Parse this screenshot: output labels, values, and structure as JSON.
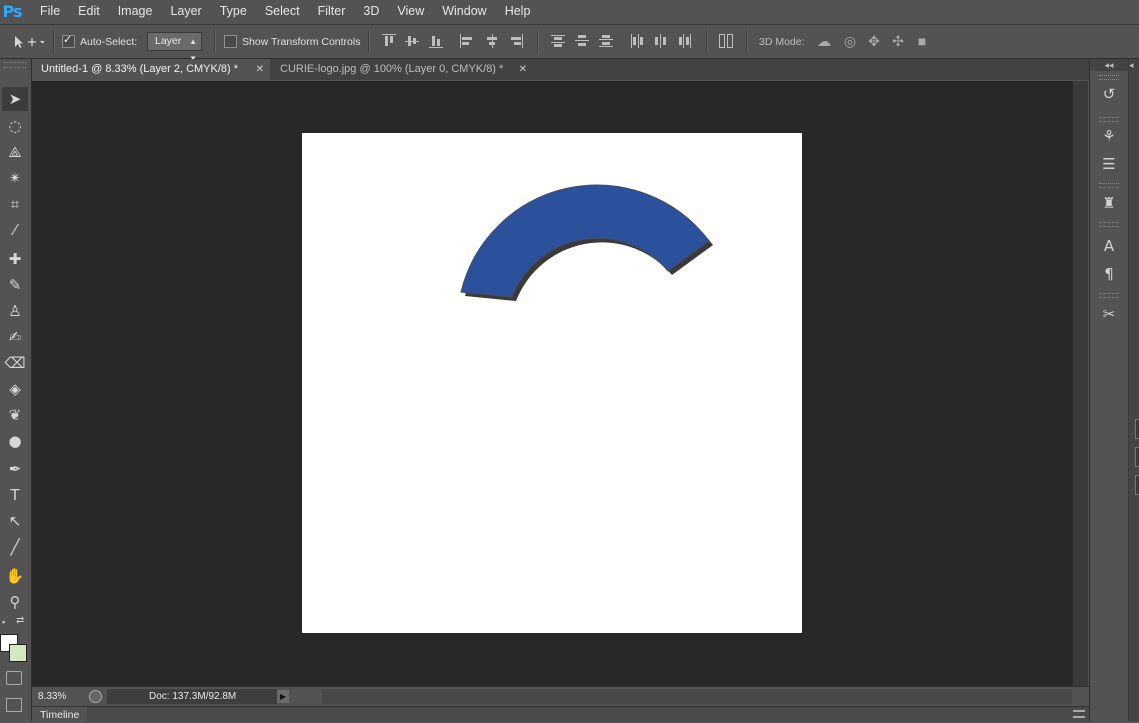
{
  "app": {
    "logo": "Ps"
  },
  "menubar": {
    "items": [
      "File",
      "Edit",
      "Image",
      "Layer",
      "Type",
      "Select",
      "Filter",
      "3D",
      "View",
      "Window",
      "Help"
    ]
  },
  "options": {
    "tool_icon": "move-tool-icon",
    "auto_select_label": "Auto-Select:",
    "auto_select_checked": true,
    "auto_select_target": "Layer",
    "show_transform_label": "Show Transform Controls",
    "show_transform_checked": false,
    "mode_3d_label": "3D Mode:"
  },
  "tabs": [
    {
      "label": "Untitled-1 @ 8.33% (Layer 2, CMYK/8) *",
      "active": true
    },
    {
      "label": "CURIE-logo.jpg @ 100% (Layer 0, CMYK/8) *",
      "active": false
    }
  ],
  "tools": [
    "move",
    "marquee",
    "lasso",
    "magic-wand",
    "crop",
    "eyedropper",
    "healing-brush",
    "brush",
    "clone-stamp",
    "history-brush",
    "eraser",
    "paint-bucket",
    "blur",
    "dodge",
    "pen",
    "type",
    "path-selection",
    "line",
    "hand",
    "zoom"
  ],
  "colors": {
    "foreground": "#ffffff",
    "background": "#d4e7c0",
    "canvas": "#ffffff",
    "arc_fill": "#2c519c",
    "arc_shadow": "#3a3a3a"
  },
  "status": {
    "zoom": "8.33%",
    "doc": "Doc: 137.3M/92.8M"
  },
  "timeline": {
    "label": "Timeline"
  }
}
